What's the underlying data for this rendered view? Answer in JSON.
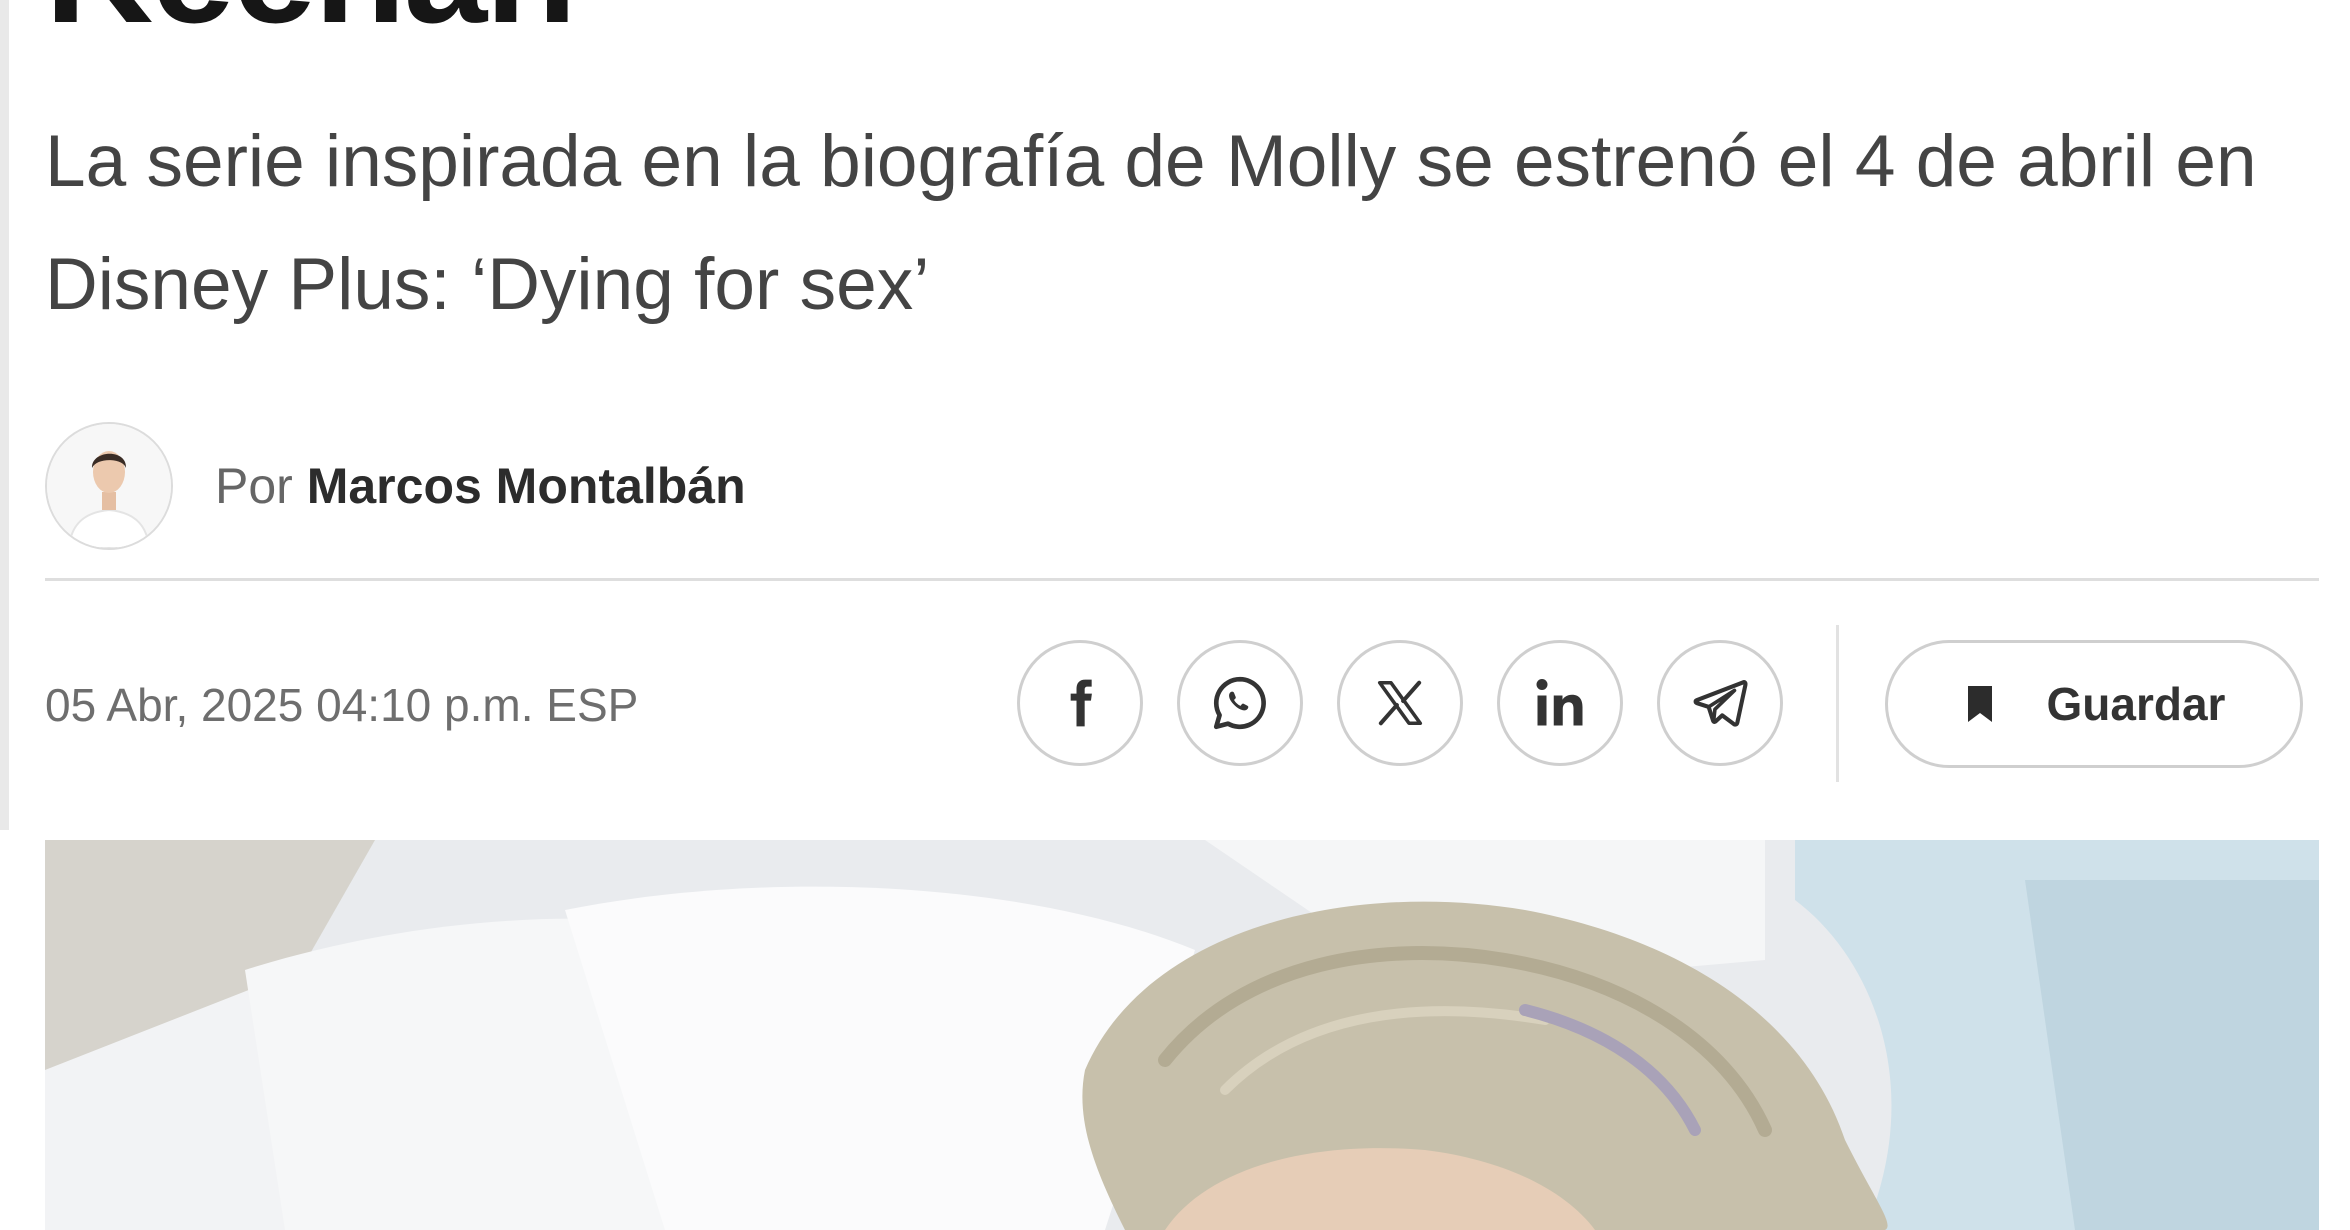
{
  "article": {
    "headline_tail": "Keenan",
    "subtitle": "La serie inspirada en la biografía de Molly se estrenó el 4 de abril en Disney Plus: ‘Dying for sex’",
    "byline": {
      "prefix": "Por",
      "author": "Marcos Montalbán"
    },
    "date": "05 Abr, 2025 04:10 p.m. ESP"
  },
  "share": {
    "buttons": [
      {
        "icon": "facebook-icon"
      },
      {
        "icon": "whatsapp-icon"
      },
      {
        "icon": "x-icon"
      },
      {
        "icon": "linkedin-icon"
      },
      {
        "icon": "telegram-icon"
      }
    ],
    "save_label": "Guardar",
    "save_icon": "bookmark-icon"
  },
  "colors": {
    "text_primary": "#161616",
    "text_secondary": "#444444",
    "muted": "#6e6e6e",
    "border": "#cfcfcf"
  }
}
